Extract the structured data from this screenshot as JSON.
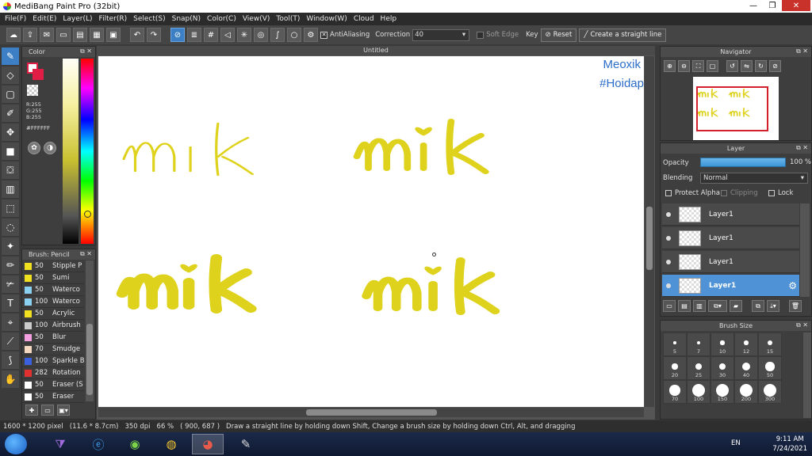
{
  "window": {
    "title": "MediBang Paint Pro (32bit)",
    "minimize": "—",
    "maximize": "❐",
    "close": "✕"
  },
  "menu": [
    "File(F)",
    "Edit(E)",
    "Layer(L)",
    "Filter(R)",
    "Select(S)",
    "Snap(N)",
    "Color(C)",
    "View(V)",
    "Tool(T)",
    "Window(W)",
    "Cloud",
    "Help"
  ],
  "toolbar": {
    "antialiasing_label": "AntiAliasing",
    "correction_label": "Correction",
    "correction_value": "40",
    "soft_edge_label": "Soft Edge",
    "key_label": "Key",
    "reset_label": "Reset",
    "straight_line_label": "Create a straight line"
  },
  "color_panel": {
    "title": "Color",
    "r": "R:255",
    "g": "G:255",
    "b": "B:255",
    "hex": "#FFFFFF",
    "fg_color": "#FFFFFF",
    "bg_color": "#E01D45"
  },
  "brush_panel": {
    "title": "Brush: Pencil",
    "items": [
      {
        "size": "50",
        "name": "Stipple P",
        "color": "#f0e020"
      },
      {
        "size": "50",
        "name": "Sumi",
        "color": "#f0e020"
      },
      {
        "size": "50",
        "name": "Waterco",
        "color": "#8ad0f0"
      },
      {
        "size": "100",
        "name": "Waterco",
        "color": "#8ad0f0"
      },
      {
        "size": "50",
        "name": "Acrylic",
        "color": "#f0e020"
      },
      {
        "size": "100",
        "name": "Airbrush",
        "color": "#cccccc"
      },
      {
        "size": "50",
        "name": "Blur",
        "color": "#f4a0e0"
      },
      {
        "size": "70",
        "name": "Smudge",
        "color": "#f4d8c0"
      },
      {
        "size": "100",
        "name": "Sparkle B",
        "color": "#3a60e0"
      },
      {
        "size": "282",
        "name": "Rotation",
        "color": "#e03030"
      },
      {
        "size": "50",
        "name": "Eraser (S",
        "color": "#ffffff"
      },
      {
        "size": "50",
        "name": "Eraser",
        "color": "#ffffff"
      }
    ]
  },
  "canvas": {
    "tab_title": "Untitled",
    "watermark_line1": "Meoxik",
    "watermark_line2": "#Hoidap",
    "text_word": "mik",
    "ink_color": "#DED21C"
  },
  "navigator": {
    "title": "Navigator"
  },
  "layer_panel": {
    "title": "Layer",
    "opacity_label": "Opacity",
    "opacity_value": "100 %",
    "opacity_level": 1.0,
    "blending_label": "Blending",
    "blending_value": "Normal",
    "protect_alpha_label": "Protect Alpha",
    "clipping_label": "Clipping",
    "lock_label": "Lock",
    "layers": [
      {
        "name": "Layer1",
        "selected": false
      },
      {
        "name": "Layer1",
        "selected": false
      },
      {
        "name": "Layer1",
        "selected": false
      },
      {
        "name": "Layer1",
        "selected": true
      }
    ]
  },
  "brush_size_panel": {
    "title": "Brush Size",
    "sizes": [
      "5",
      "7",
      "10",
      "12",
      "15",
      "20",
      "25",
      "30",
      "40",
      "50",
      "70",
      "100",
      "150",
      "200",
      "300"
    ]
  },
  "status": {
    "dimensions": "1600 * 1200 pixel",
    "physical": "(11.6 * 8.7cm)",
    "dpi": "350 dpi",
    "zoom": "66 %",
    "coords": "( 900, 687 )",
    "hint": "Draw a straight line by holding down Shift, Change a brush size by holding down Ctrl, Alt, and dragging"
  },
  "taskbar": {
    "lang": "EN",
    "time": "9:11 AM",
    "date": "7/24/2021"
  }
}
